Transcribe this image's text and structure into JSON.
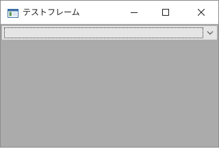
{
  "window": {
    "title": "テストフレーム",
    "icon": "java-frame-icon",
    "controls": [
      "minimize-icon",
      "maximize-icon",
      "close-icon"
    ]
  },
  "combo": {
    "selected_value": "",
    "arrow_icon": "chevron-down-icon"
  },
  "colors": {
    "titlebar": "#ffffff",
    "content": "#ababab",
    "combo_bg": "#e5e5e5",
    "combo_border": "#adadad"
  }
}
